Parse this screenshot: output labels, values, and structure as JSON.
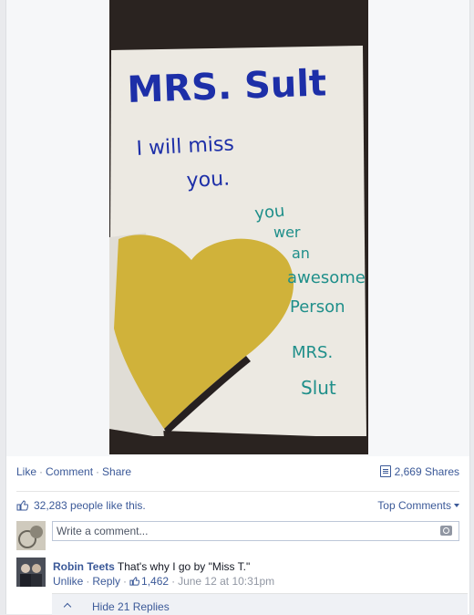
{
  "photo": {
    "note_lines": [
      "MRS. Sult",
      "I will miss",
      "you.",
      "you",
      "wer",
      "an",
      "awesome",
      "Person",
      "MRS.",
      "Slut"
    ]
  },
  "actions": {
    "like": "Like",
    "comment": "Comment",
    "share": "Share",
    "separator": "·",
    "shares_count": "2,669 Shares"
  },
  "likes": {
    "text": "32,283 people like this.",
    "top_comments": "Top Comments"
  },
  "composer": {
    "placeholder": "Write a comment..."
  },
  "comment": {
    "author": "Robin Teets",
    "text": "That's why I go by \"Miss T.\"",
    "unlike": "Unlike",
    "reply": "Reply",
    "like_count": "1,462",
    "timestamp": "June 12 at 10:31pm"
  },
  "replies": {
    "label": "Hide 21 Replies"
  },
  "colors": {
    "link": "#3b5998",
    "meta": "#9197a3",
    "ink_blue": "#1d2fa8",
    "ink_teal": "#1f8f8a",
    "heart": "#d4b43a"
  }
}
